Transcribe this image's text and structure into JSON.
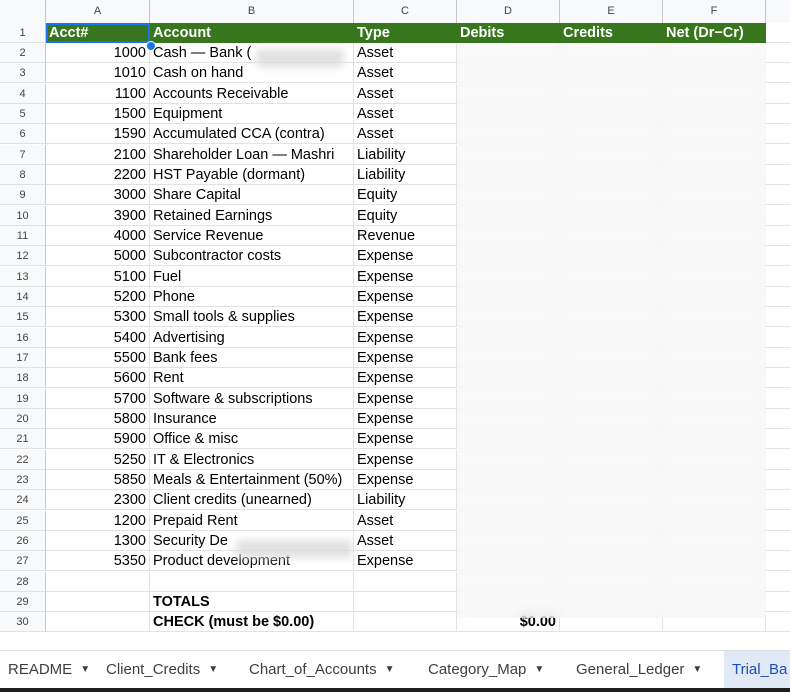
{
  "columns": [
    "A",
    "B",
    "C",
    "D",
    "E",
    "F"
  ],
  "header_row": {
    "row": "1",
    "acct": "Acct#",
    "account": "Account",
    "type": "Type",
    "debits": "Debits",
    "credits": "Credits",
    "net": "Net (Dr−Cr)"
  },
  "rows": [
    {
      "row": "2",
      "acct": "1000",
      "account": "Cash — Bank (",
      "type": "Asset"
    },
    {
      "row": "3",
      "acct": "1010",
      "account": "Cash on hand",
      "type": "Asset"
    },
    {
      "row": "4",
      "acct": "1100",
      "account": "Accounts Receivable",
      "type": "Asset"
    },
    {
      "row": "5",
      "acct": "1500",
      "account": "Equipment",
      "type": "Asset"
    },
    {
      "row": "6",
      "acct": "1590",
      "account": "Accumulated CCA (contra)",
      "type": "Asset"
    },
    {
      "row": "7",
      "acct": "2100",
      "account": "Shareholder Loan — Mashri",
      "type": "Liability"
    },
    {
      "row": "8",
      "acct": "2200",
      "account": "HST Payable (dormant)",
      "type": "Liability"
    },
    {
      "row": "9",
      "acct": "3000",
      "account": "Share Capital",
      "type": "Equity"
    },
    {
      "row": "10",
      "acct": "3900",
      "account": "Retained Earnings",
      "type": "Equity"
    },
    {
      "row": "11",
      "acct": "4000",
      "account": "Service Revenue",
      "type": "Revenue"
    },
    {
      "row": "12",
      "acct": "5000",
      "account": "Subcontractor costs",
      "type": "Expense"
    },
    {
      "row": "13",
      "acct": "5100",
      "account": "Fuel",
      "type": "Expense"
    },
    {
      "row": "14",
      "acct": "5200",
      "account": "Phone",
      "type": "Expense"
    },
    {
      "row": "15",
      "acct": "5300",
      "account": "Small tools & supplies",
      "type": "Expense"
    },
    {
      "row": "16",
      "acct": "5400",
      "account": "Advertising",
      "type": "Expense"
    },
    {
      "row": "17",
      "acct": "5500",
      "account": "Bank fees",
      "type": "Expense"
    },
    {
      "row": "18",
      "acct": "5600",
      "account": "Rent",
      "type": "Expense"
    },
    {
      "row": "19",
      "acct": "5700",
      "account": "Software & subscriptions",
      "type": "Expense"
    },
    {
      "row": "20",
      "acct": "5800",
      "account": "Insurance",
      "type": "Expense"
    },
    {
      "row": "21",
      "acct": "5900",
      "account": "Office & misc",
      "type": "Expense"
    },
    {
      "row": "22",
      "acct": "5250",
      "account": "IT & Electronics",
      "type": "Expense"
    },
    {
      "row": "23",
      "acct": "5850",
      "account": "Meals & Entertainment (50%)",
      "type": "Expense"
    },
    {
      "row": "24",
      "acct": "2300",
      "account": "Client credits (unearned)",
      "type": "Liability"
    },
    {
      "row": "25",
      "acct": "1200",
      "account": "Prepaid Rent",
      "type": "Asset"
    },
    {
      "row": "26",
      "acct": "1300",
      "account": "Security De",
      "type": "Asset"
    },
    {
      "row": "27",
      "acct": "5350",
      "account": "Product development",
      "type": "Expense"
    }
  ],
  "empty_row": {
    "row": "28"
  },
  "totals_row": {
    "row": "29",
    "label": "TOTALS"
  },
  "check_row": {
    "row": "30",
    "label": "CHECK (must be $0.00)",
    "value": "$0.00"
  },
  "tabs": [
    {
      "label": "README",
      "active": false
    },
    {
      "label": "Client_Credits",
      "active": false
    },
    {
      "label": "Chart_of_Accounts",
      "active": false
    },
    {
      "label": "Category_Map",
      "active": false
    },
    {
      "label": "General_Ledger",
      "active": false
    },
    {
      "label": "Trial_Ba",
      "active": true
    }
  ],
  "colors": {
    "header_bg": "#38761d",
    "header_text": "#ffffff",
    "active_tab_bg": "#e1e9f7",
    "active_tab_text": "#1a4fb5",
    "selection": "#1a73e8"
  },
  "icons": {
    "tab_menu": "caret-down-icon"
  }
}
